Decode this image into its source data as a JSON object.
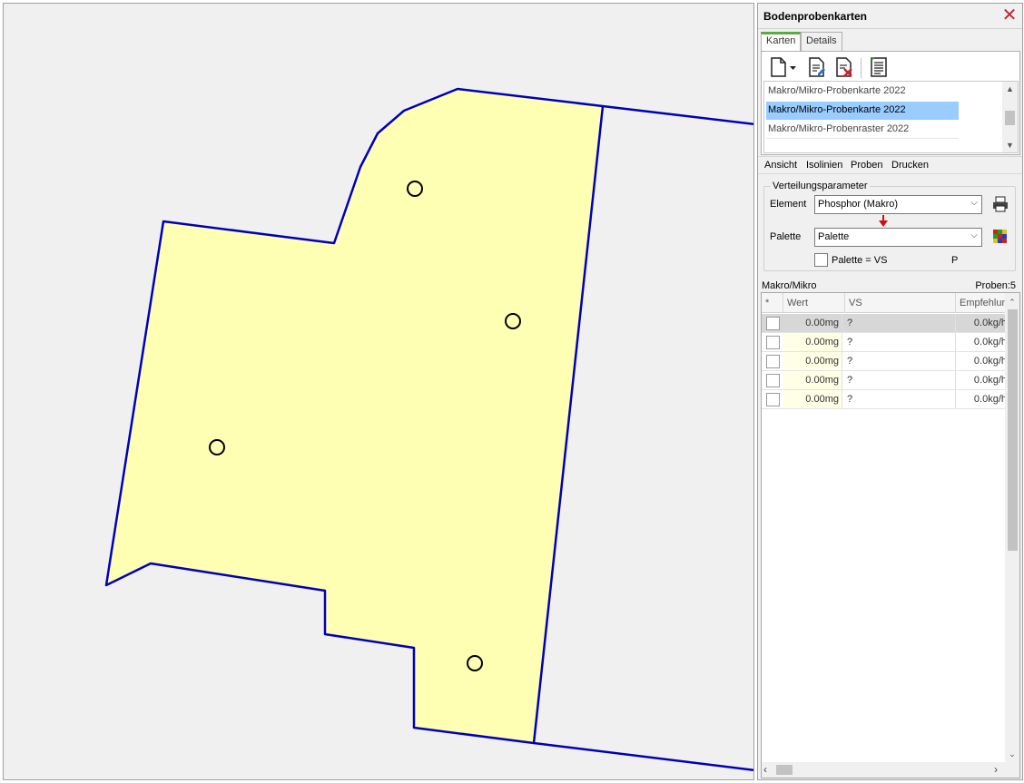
{
  "panel": {
    "title": "Bodenprobenkarten",
    "tabs": [
      {
        "label": "Karten",
        "active": true
      },
      {
        "label": "Details",
        "active": false
      }
    ],
    "toolbar": {
      "icons": [
        "new-document-icon",
        "dropdown-arrow-icon",
        "edit-document-icon",
        "delete-document-icon",
        "report-icon"
      ]
    },
    "maps_list": [
      {
        "label": "Makro/Mikro-Probenkarte 2022",
        "selected": false
      },
      {
        "label": "Makro/Mikro-Probenkarte 2022",
        "selected": true
      },
      {
        "label": "Makro/Mikro-Probenraster 2022",
        "selected": false
      }
    ],
    "menu": [
      "Ansicht",
      "Isolinien",
      "Proben",
      "Drucken"
    ],
    "distribution": {
      "legend": "Verteilungsparameter",
      "element_label": "Element",
      "element_value": "Phosphor (Makro)",
      "palette_label": "Palette",
      "palette_value": "Palette",
      "palette_vs_label": "Palette = VS",
      "palette_vs_checked": false,
      "symbol": "P"
    },
    "status": {
      "left": "Makro/Mikro",
      "right": "Proben:5"
    },
    "grid": {
      "headers": [
        "*",
        "Wert",
        "VS",
        "Empfehlun"
      ],
      "rows": [
        {
          "wert": "0.00mg",
          "vs": "?",
          "empfehlung": "0.0kg/h"
        },
        {
          "wert": "0.00mg",
          "vs": "?",
          "empfehlung": "0.0kg/h"
        },
        {
          "wert": "0.00mg",
          "vs": "?",
          "empfehlung": "0.0kg/h"
        },
        {
          "wert": "0.00mg",
          "vs": "?",
          "empfehlung": "0.0kg/h"
        },
        {
          "wert": "0.00mg",
          "vs": "?",
          "empfehlung": "0.0kg/h"
        }
      ]
    }
  },
  "map": {
    "field_fill": "#ffffb4",
    "boundary_color": "#0000b8",
    "background": "#f0f0f0",
    "sample_points": 4
  }
}
